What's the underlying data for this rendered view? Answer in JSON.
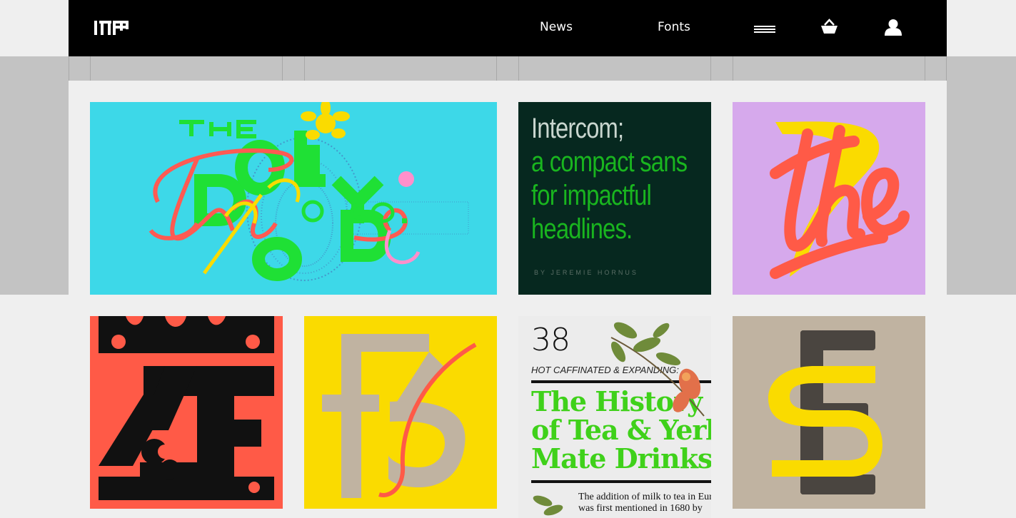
{
  "header": {
    "logo_name": "ITF",
    "nav": [
      {
        "label": "News"
      },
      {
        "label": "Fonts"
      }
    ],
    "icons": [
      "menu-icon",
      "basket-icon",
      "user-icon"
    ]
  },
  "tiles": [
    {
      "name": "the-dilly-dop-co",
      "bg": "#3dd8e8"
    },
    {
      "name": "intercom",
      "bg": "#06281f",
      "lines": [
        "Intercom;",
        "a compact sans",
        "for impactful",
        "headlines."
      ],
      "byline": "BY JEREMIE HORNUS"
    },
    {
      "name": "the-lettering",
      "bg": "#d6a9ec"
    },
    {
      "name": "ae-ornate",
      "bg": "#ff5a47"
    },
    {
      "name": "f3-mono",
      "bg": "#fadb00"
    },
    {
      "name": "tea-magazine",
      "bg": "#ececec",
      "number": "38",
      "kicker": "HOT CAFFINATED & EXPANDING:",
      "headline": [
        "The History",
        "of Tea & Yerba",
        "Mate Drinks"
      ],
      "body": [
        "The addition of milk to tea in Europe",
        "was first mentioned in 1680 by"
      ]
    },
    {
      "name": "es-stacked",
      "bg": "#c0b3a1"
    }
  ],
  "colors": {
    "header": "#000000",
    "band": "#c3c3c3",
    "page": "#efefef",
    "green": "#3fd11a",
    "coral": "#ff5a47",
    "yellow": "#fadb00"
  }
}
